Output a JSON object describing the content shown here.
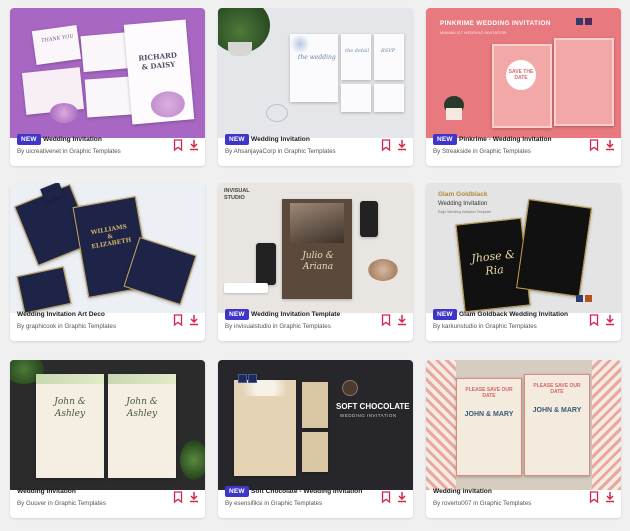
{
  "cards": [
    {
      "new": true,
      "title": "Wedding Invitation",
      "author": "By uicreativenet in Graphic Templates"
    },
    {
      "new": true,
      "title": "Wedding Invitation",
      "author": "By AhsanjayaCorp in Graphic Templates"
    },
    {
      "new": true,
      "title": "Pinkrime - Wedding Invitation",
      "author": "By Streakside in Graphic Templates"
    },
    {
      "new": false,
      "title": "Wedding Invitation Art Deco",
      "author": "By graphicook in Graphic Templates"
    },
    {
      "new": true,
      "title": "Wedding Invitation Template",
      "author": "By invisualstudio in Graphic Templates"
    },
    {
      "new": true,
      "title": "Glam Goldback Wedding Invitation",
      "author": "By karkunstudio in Graphic Templates"
    },
    {
      "new": false,
      "title": "Wedding Invitation",
      "author": "By Guuver in Graphic Templates"
    },
    {
      "new": true,
      "title": "Soft Chocolate - Wedding Invitation",
      "author": "By esensifiksi in Graphic Templates"
    },
    {
      "new": false,
      "title": "Wedding invitation",
      "author": "By roverto007 in Graphic Templates"
    }
  ],
  "badge_label": "NEW",
  "preview_text": {
    "c1_thank": "THANK YOU",
    "c1_names": "RICHARD & DAISY",
    "c2_wedding": "the wedding",
    "c2_detail": "the detail",
    "c2_rsvp": "RSVP",
    "c3_heading": "PINKRIME WEDDING INVITATION",
    "c3_sub": "MINIMALIST WEDDING INVITATION",
    "c3_save": "SAVE THE DATE",
    "c4_names": "WILLIAMS & ELIZABETH",
    "c5_studio": "INVISUAL STUDIO",
    "c5_names": "Julio & Ariana",
    "c6_brand": "Glam Goldblack",
    "c6_heading": "Wedding Invitation",
    "c6_sub": "Edge Wedding Invitation Template",
    "c6_names": "Jhose & Ria",
    "c7_names": "John & Ashley",
    "c8_heading": "SOFT CHOCOLATE",
    "c8_sub": "WEDDING INVITATION",
    "c9_save": "PLEASE SAVE OUR DATE",
    "c9_names": "JOHN & MARY"
  },
  "colors": {
    "badge": "#3f36c9",
    "action": "#d6254f",
    "c1_bg": "#a767c3",
    "c3_bg": "#e8797f",
    "c4_bg": "#eceff4",
    "c5_bg": "#e9e6e2",
    "c8_bg": "#27262a",
    "c9_bg": "#d6ccc0"
  },
  "icons": {
    "bookmark": "bookmark-icon",
    "download": "download-icon"
  }
}
